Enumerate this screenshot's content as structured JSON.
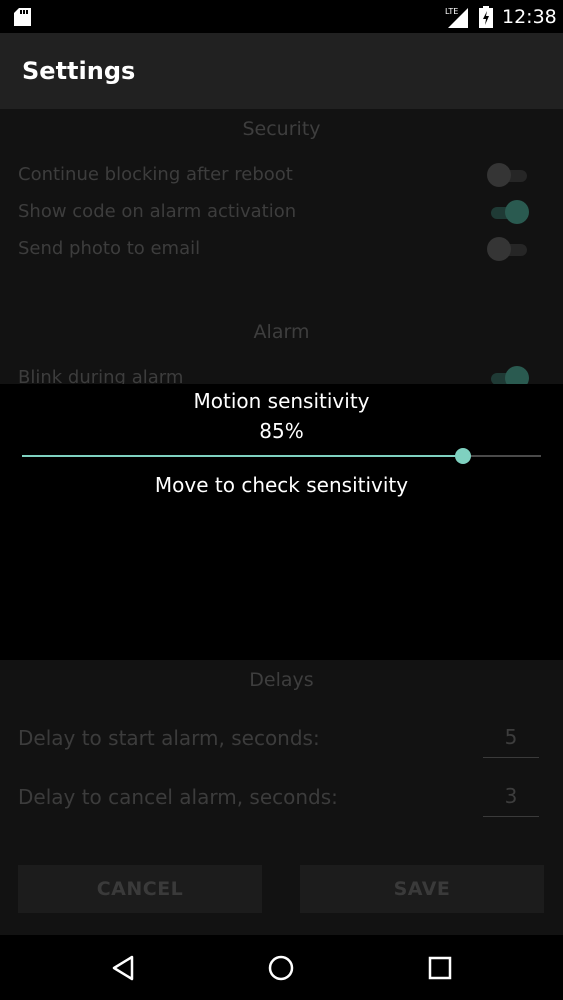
{
  "status_bar": {
    "time": "12:38",
    "network_label": "LTE",
    "icons": [
      "sd-card-icon",
      "lte-signal-icon",
      "battery-charging-icon"
    ]
  },
  "app_bar": {
    "title": "Settings"
  },
  "security": {
    "title": "Security",
    "items": [
      {
        "label": "Continue blocking after reboot",
        "enabled": false
      },
      {
        "label": "Show code on alarm activation",
        "enabled": true
      },
      {
        "label": "Send photo to email",
        "enabled": false
      }
    ]
  },
  "alarm": {
    "title": "Alarm",
    "items": [
      {
        "label": "Blink during alarm",
        "enabled": true
      }
    ]
  },
  "dialog": {
    "title": "Motion sensitivity",
    "value_text": "85%",
    "value": 85,
    "hint": "Move to check sensitivity"
  },
  "delays": {
    "title": "Delays",
    "start": {
      "label": "Delay to start alarm, seconds:",
      "value": "5"
    },
    "cancel": {
      "label": "Delay to cancel alarm, seconds:",
      "value": "3"
    }
  },
  "buttons": {
    "cancel": "CANCEL",
    "save": "SAVE"
  },
  "colors": {
    "accent": "#7fd1c0",
    "background": "#121212",
    "app_bar": "#212121"
  },
  "nav": {
    "icons": [
      "back-icon",
      "home-icon",
      "recents-icon"
    ]
  }
}
